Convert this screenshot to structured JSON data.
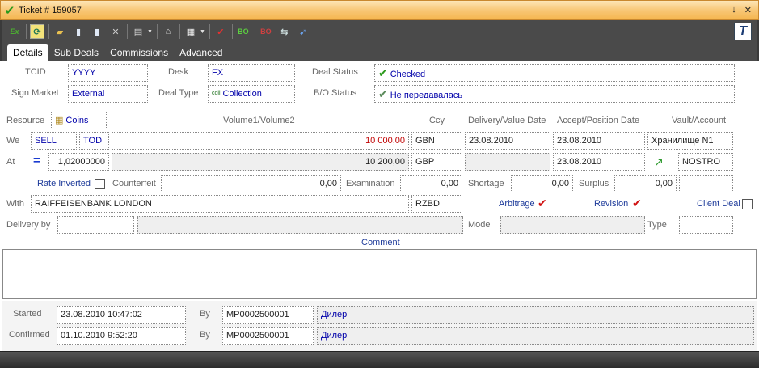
{
  "window": {
    "title": "Ticket # 159057",
    "pin": "↓",
    "close": "✕"
  },
  "toolbar": {
    "logo": "T"
  },
  "tabs": [
    "Details",
    "Sub Deals",
    "Commissions",
    "Advanced"
  ],
  "labels": {
    "tcid": "TCID",
    "desk": "Desk",
    "deal_status": "Deal Status",
    "sign_market": "Sign Market",
    "deal_type": "Deal Type",
    "bo_status": "B/O Status",
    "resource": "Resource",
    "volume": "Volume1/Volume2",
    "ccy": "Ccy",
    "delivery_date": "Delivery/Value Date",
    "accept_date": "Accept/Position Date",
    "vault": "Vault/Account",
    "we": "We",
    "at": "At",
    "rate_inverted": "Rate Inverted",
    "counterfeit": "Counterfeit",
    "examination": "Examination",
    "shortage": "Shortage",
    "surplus": "Surplus",
    "with": "With",
    "arbitrage": "Arbitrage",
    "revision": "Revision",
    "client_deal": "Client Deal",
    "delivery_by": "Delivery by",
    "mode": "Mode",
    "type": "Type",
    "comment": "Comment",
    "started": "Started",
    "confirmed": "Confirmed",
    "by": "By"
  },
  "values": {
    "tcid": "YYYY",
    "desk": "FX",
    "deal_status": "Checked",
    "sign_market": "External",
    "deal_type": "Collection",
    "bo_status": "Не передавалась",
    "resource": "Coins",
    "we_side": "SELL",
    "we_tod": "TOD",
    "volume1": "10 000,00",
    "ccy1": "GBN",
    "delivery_date": "23.08.2010",
    "accept_date1": "23.08.2010",
    "vault": "Хранилище N1",
    "rate": "1,02000000",
    "volume2": "10 200,00",
    "ccy2": "GBP",
    "accept_date2": "23.08.2010",
    "account": "NOSTRO",
    "counterfeit": "0,00",
    "examination": "0,00",
    "shortage": "0,00",
    "surplus": "0,00",
    "with": "RAIFFEISENBANK LONDON",
    "with_code": "RZBD",
    "started": "23.08.2010 10:47:02",
    "started_by_id": "MP0002500001",
    "started_by_name": "Дилер",
    "confirmed": "01.10.2010 9:52:20",
    "confirmed_by_id": "MP0002500001",
    "confirmed_by_name": "Дилер"
  },
  "icons": {
    "deal_type_icon": "coll",
    "colors": {
      "accent": "#f8c777",
      "blue_text": "#0000aa",
      "red_value": "#c00000",
      "check_green": "#2c9a1c"
    }
  }
}
